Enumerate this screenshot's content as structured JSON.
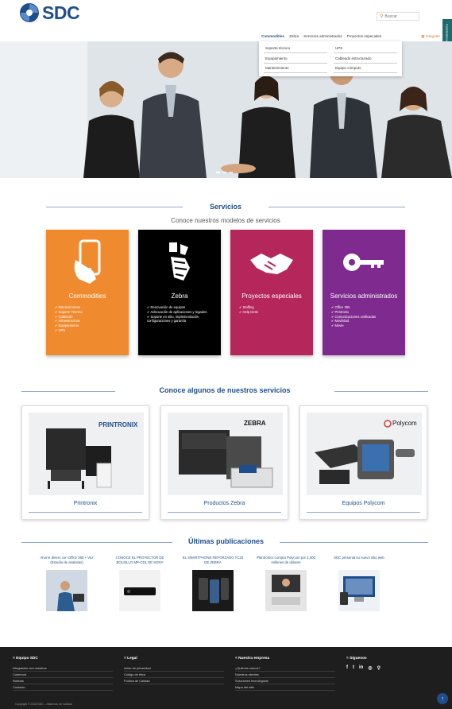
{
  "header": {
    "logo_text": "SDC",
    "search_placeholder": "Buscar",
    "side_tab": "Contáctenos"
  },
  "nav": {
    "items": [
      "Commodities",
      "Zebra",
      "Servicios administrados",
      "Proyectos especiales"
    ],
    "integrate": "Intégrate"
  },
  "dropdown": {
    "items": [
      "Soporte técnico",
      "UPS",
      "Equipamiento",
      "Cableado estructurado",
      "Mantenimiento",
      "Equipo cómputo"
    ]
  },
  "services": {
    "title": "Servicios",
    "subtitle": "Conoce nuestros modelos de servicios",
    "cards": [
      {
        "title": "Commodities",
        "color": "#f08a2e",
        "items": [
          "Mantenimiento",
          "Soporte Técnico",
          "Cableado",
          "Infraestructura",
          "Equipamiento",
          "UPS"
        ]
      },
      {
        "title": "Zebra",
        "color": "#000000",
        "items": [
          "Renovación de equipos",
          "Adecuación de aplicaciones y legados",
          "Soporte en sitio, implementación, configuraciones y garantía"
        ]
      },
      {
        "title": "Proyectos especiales",
        "color": "#b5265a",
        "items": [
          "Staffing",
          "Help Desk"
        ]
      },
      {
        "title": "Servicios administrados",
        "color": "#7e2a8e",
        "items": [
          "Office 365",
          "Printronix",
          "Comunicaciones Unificadas",
          "Movilidad",
          "Movie"
        ]
      }
    ]
  },
  "products": {
    "title": "Conoce algunos de nuestros servicios",
    "items": [
      {
        "label": "Printronix",
        "brand": "PRINTRONIX"
      },
      {
        "label": "Productos Zebra",
        "brand": "ZEBRA"
      },
      {
        "label": "Equipos Polycom",
        "brand": "Polycom"
      }
    ]
  },
  "publications": {
    "title": "Últimas publicaciones",
    "items": [
      "Ahorre dinero con Office 365 + Voz (Estudio de analistas)",
      "CONOCE EL PROYECTOR DE BOLSILLO MP-CD1 DE SONY",
      "EL SMARTPHONE REFORZADO TC25 DE ZEBRA",
      "Plantronics compra Polycom por 2,000 millones de dólares",
      "SDC presenta su nuevo sitio web"
    ]
  },
  "footer": {
    "cols": [
      {
        "head": "Equipo SDC",
        "links": [
          "Integración con nosotros",
          "Cobertura",
          "Noticias",
          "Contacto"
        ]
      },
      {
        "head": "Legal",
        "links": [
          "Aviso de privacidad",
          "Código de ética",
          "Política de Calidad"
        ]
      },
      {
        "head": "Nuestra empresa",
        "links": [
          "¿Quiénes somos?",
          "Nuestros clientes",
          "Soluciones tecnológicas",
          "Mapa del sitio"
        ]
      },
      {
        "head": "Síguenos",
        "links": []
      }
    ],
    "social": [
      "f",
      "t",
      "in",
      "◎",
      "⚲"
    ],
    "copyright": "Copyright © 2018 SDC – Sistemas de Calidad",
    "to_top": "↑"
  }
}
